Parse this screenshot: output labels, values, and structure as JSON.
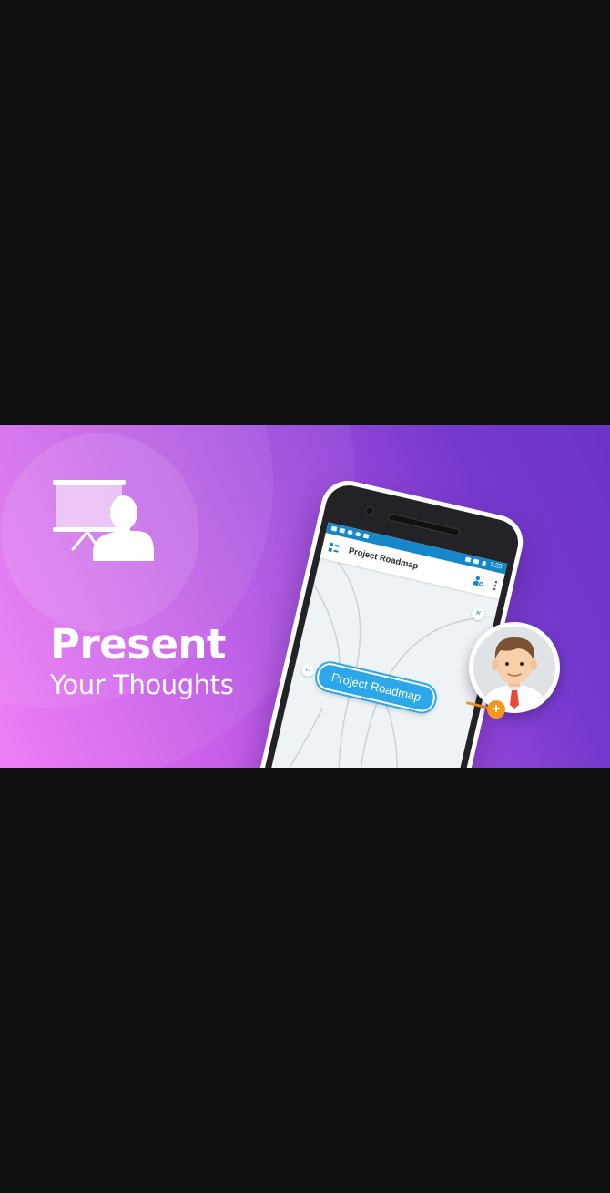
{
  "banner": {
    "title": "Present",
    "subtitle": "Your Thoughts",
    "gradient_colors": [
      "#ef77f6",
      "#c65ee8",
      "#9a49dc",
      "#6a34c6"
    ],
    "hero_icon": "presenter-icon"
  },
  "phone": {
    "status_bar": {
      "time": "1:23",
      "color": "#1687c8"
    },
    "toolbar": {
      "title": "Project Roadmap",
      "logo_icon": "app-logo-icon",
      "collab_icon": "collaborator-add-icon",
      "menu_icon": "more-vert-icon"
    },
    "mind_map": {
      "central_node": "Project Roadmap",
      "node_color": "#2ca7e9",
      "close_symbol": "×",
      "back_symbol": "←"
    }
  },
  "collaborator": {
    "avatar_icon": "user-avatar",
    "add_symbol": "+",
    "accent_color": "#f39a1e"
  }
}
